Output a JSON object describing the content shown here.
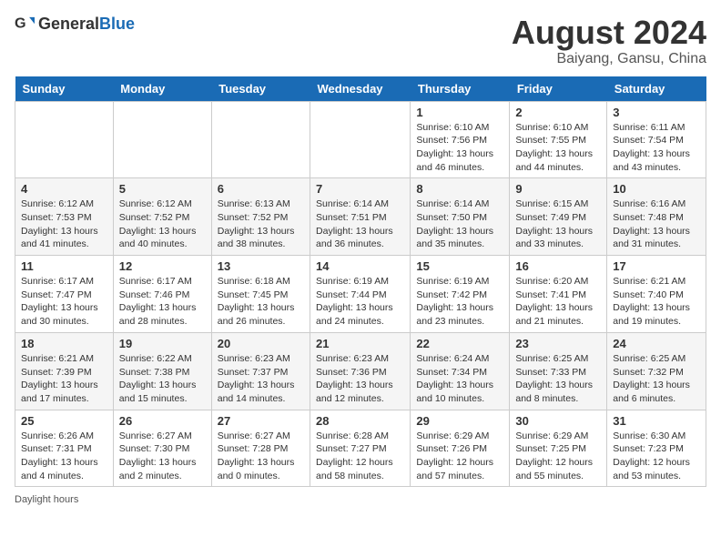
{
  "header": {
    "logo_general": "General",
    "logo_blue": "Blue",
    "main_title": "August 2024",
    "sub_title": "Baiyang, Gansu, China"
  },
  "days_of_week": [
    "Sunday",
    "Monday",
    "Tuesday",
    "Wednesday",
    "Thursday",
    "Friday",
    "Saturday"
  ],
  "weeks": [
    [
      {
        "date": "",
        "info": ""
      },
      {
        "date": "",
        "info": ""
      },
      {
        "date": "",
        "info": ""
      },
      {
        "date": "",
        "info": ""
      },
      {
        "date": "1",
        "info": "Sunrise: 6:10 AM\nSunset: 7:56 PM\nDaylight: 13 hours and 46 minutes."
      },
      {
        "date": "2",
        "info": "Sunrise: 6:10 AM\nSunset: 7:55 PM\nDaylight: 13 hours and 44 minutes."
      },
      {
        "date": "3",
        "info": "Sunrise: 6:11 AM\nSunset: 7:54 PM\nDaylight: 13 hours and 43 minutes."
      }
    ],
    [
      {
        "date": "4",
        "info": "Sunrise: 6:12 AM\nSunset: 7:53 PM\nDaylight: 13 hours and 41 minutes."
      },
      {
        "date": "5",
        "info": "Sunrise: 6:12 AM\nSunset: 7:52 PM\nDaylight: 13 hours and 40 minutes."
      },
      {
        "date": "6",
        "info": "Sunrise: 6:13 AM\nSunset: 7:52 PM\nDaylight: 13 hours and 38 minutes."
      },
      {
        "date": "7",
        "info": "Sunrise: 6:14 AM\nSunset: 7:51 PM\nDaylight: 13 hours and 36 minutes."
      },
      {
        "date": "8",
        "info": "Sunrise: 6:14 AM\nSunset: 7:50 PM\nDaylight: 13 hours and 35 minutes."
      },
      {
        "date": "9",
        "info": "Sunrise: 6:15 AM\nSunset: 7:49 PM\nDaylight: 13 hours and 33 minutes."
      },
      {
        "date": "10",
        "info": "Sunrise: 6:16 AM\nSunset: 7:48 PM\nDaylight: 13 hours and 31 minutes."
      }
    ],
    [
      {
        "date": "11",
        "info": "Sunrise: 6:17 AM\nSunset: 7:47 PM\nDaylight: 13 hours and 30 minutes."
      },
      {
        "date": "12",
        "info": "Sunrise: 6:17 AM\nSunset: 7:46 PM\nDaylight: 13 hours and 28 minutes."
      },
      {
        "date": "13",
        "info": "Sunrise: 6:18 AM\nSunset: 7:45 PM\nDaylight: 13 hours and 26 minutes."
      },
      {
        "date": "14",
        "info": "Sunrise: 6:19 AM\nSunset: 7:44 PM\nDaylight: 13 hours and 24 minutes."
      },
      {
        "date": "15",
        "info": "Sunrise: 6:19 AM\nSunset: 7:42 PM\nDaylight: 13 hours and 23 minutes."
      },
      {
        "date": "16",
        "info": "Sunrise: 6:20 AM\nSunset: 7:41 PM\nDaylight: 13 hours and 21 minutes."
      },
      {
        "date": "17",
        "info": "Sunrise: 6:21 AM\nSunset: 7:40 PM\nDaylight: 13 hours and 19 minutes."
      }
    ],
    [
      {
        "date": "18",
        "info": "Sunrise: 6:21 AM\nSunset: 7:39 PM\nDaylight: 13 hours and 17 minutes."
      },
      {
        "date": "19",
        "info": "Sunrise: 6:22 AM\nSunset: 7:38 PM\nDaylight: 13 hours and 15 minutes."
      },
      {
        "date": "20",
        "info": "Sunrise: 6:23 AM\nSunset: 7:37 PM\nDaylight: 13 hours and 14 minutes."
      },
      {
        "date": "21",
        "info": "Sunrise: 6:23 AM\nSunset: 7:36 PM\nDaylight: 13 hours and 12 minutes."
      },
      {
        "date": "22",
        "info": "Sunrise: 6:24 AM\nSunset: 7:34 PM\nDaylight: 13 hours and 10 minutes."
      },
      {
        "date": "23",
        "info": "Sunrise: 6:25 AM\nSunset: 7:33 PM\nDaylight: 13 hours and 8 minutes."
      },
      {
        "date": "24",
        "info": "Sunrise: 6:25 AM\nSunset: 7:32 PM\nDaylight: 13 hours and 6 minutes."
      }
    ],
    [
      {
        "date": "25",
        "info": "Sunrise: 6:26 AM\nSunset: 7:31 PM\nDaylight: 13 hours and 4 minutes."
      },
      {
        "date": "26",
        "info": "Sunrise: 6:27 AM\nSunset: 7:30 PM\nDaylight: 13 hours and 2 minutes."
      },
      {
        "date": "27",
        "info": "Sunrise: 6:27 AM\nSunset: 7:28 PM\nDaylight: 13 hours and 0 minutes."
      },
      {
        "date": "28",
        "info": "Sunrise: 6:28 AM\nSunset: 7:27 PM\nDaylight: 12 hours and 58 minutes."
      },
      {
        "date": "29",
        "info": "Sunrise: 6:29 AM\nSunset: 7:26 PM\nDaylight: 12 hours and 57 minutes."
      },
      {
        "date": "30",
        "info": "Sunrise: 6:29 AM\nSunset: 7:25 PM\nDaylight: 12 hours and 55 minutes."
      },
      {
        "date": "31",
        "info": "Sunrise: 6:30 AM\nSunset: 7:23 PM\nDaylight: 12 hours and 53 minutes."
      }
    ]
  ],
  "footer": {
    "daylight_label": "Daylight hours"
  }
}
